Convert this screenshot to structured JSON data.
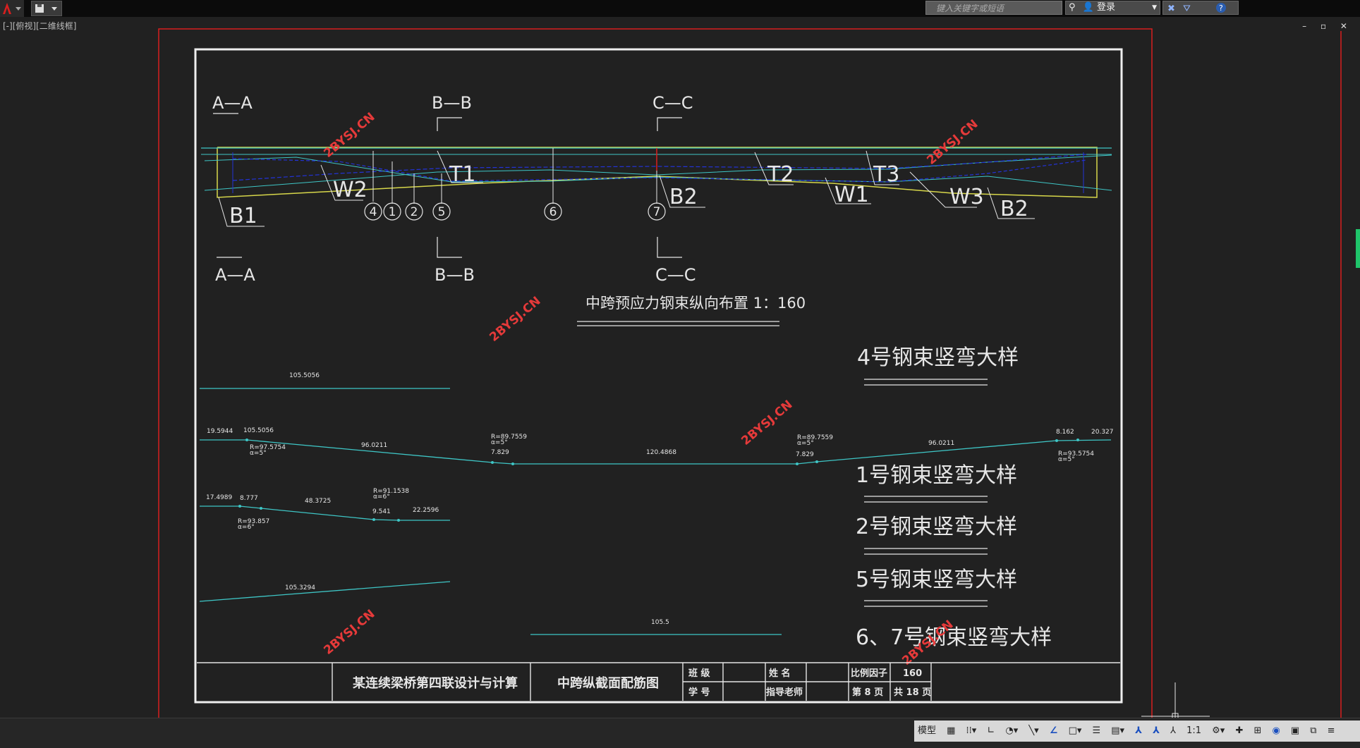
{
  "topbar": {
    "search_placeholder": "键入关键字或短语",
    "login_label": "登录"
  },
  "viewport_label": "[-][俯视][二维线框]",
  "window_controls": "– ▫ ✕",
  "drawing": {
    "section_labels": {
      "aa_top": "A—A",
      "aa_bottom": "A—A",
      "bb_top": "B—B",
      "bb_bottom": "B—B",
      "cc_top": "C—C",
      "cc_bottom": "C—C"
    },
    "tendon_labels": {
      "w2": "W2",
      "t1": "T1",
      "b2_mid": "B2",
      "b1": "B1",
      "t2": "T2",
      "w1": "W1",
      "t3": "T3",
      "w3": "W3",
      "b2_right": "B2"
    },
    "circle_numbers": [
      "4",
      "1",
      "2",
      "5",
      "6",
      "7"
    ],
    "main_title": "中跨预应力钢束纵向布置 1：160",
    "detail_titles": {
      "d4": "4号钢束竖弯大样",
      "d1": "1号钢束竖弯大样",
      "d2": "2号钢束竖弯大样",
      "d5": "5号钢束竖弯大样",
      "d67": "6、7号钢束竖弯大样"
    },
    "detail4": {
      "length": "105.5056"
    },
    "detail1": {
      "left_end": "19.5944",
      "seg1": "105.5056",
      "r1": "R=97.5754",
      "a1": "α=5°",
      "seg2": "96.0211",
      "r2": "R=89.7559",
      "a2": "α=5°",
      "p1": "7.829",
      "mid": "120.4868",
      "r3": "R=89.7559",
      "a3": "α=5°",
      "p2": "7.829",
      "seg3": "96.0211",
      "p3": "8.162",
      "right_end": "20.327",
      "r4": "R=93.5754",
      "a4": "α=5°"
    },
    "detail2": {
      "left_end": "17.4989",
      "p1": "8.777",
      "r1": "R=93.857",
      "a1": "α=6°",
      "seg": "48.3725",
      "r2": "R=91.1538",
      "a2": "α=6°",
      "p2": "9.541",
      "right": "22.2596"
    },
    "detail5": {
      "length": "105.3294"
    },
    "detail67": {
      "length": "105.5"
    },
    "watermark": "2BYSJ.CN",
    "title_block": {
      "project": "某连续梁桥第四联设计与计算",
      "drawing_name": "中跨纵截面配筋图",
      "class_label": "班 级",
      "name_label": "姓 名",
      "scale_label": "比例因子",
      "scale_value": "160",
      "student_id_label": "学 号",
      "advisor_label": "指导老师",
      "page_label": "第 8 页",
      "total_label": "共 18 页"
    }
  },
  "statusbar": {
    "model_label": "模型",
    "scale_label": "1:1"
  },
  "colors": {
    "cyan": "#3ec6c6",
    "yellow": "#d7d74a",
    "blue": "#2333d8",
    "red": "#d81f1f",
    "white": "#e6e6e6"
  }
}
